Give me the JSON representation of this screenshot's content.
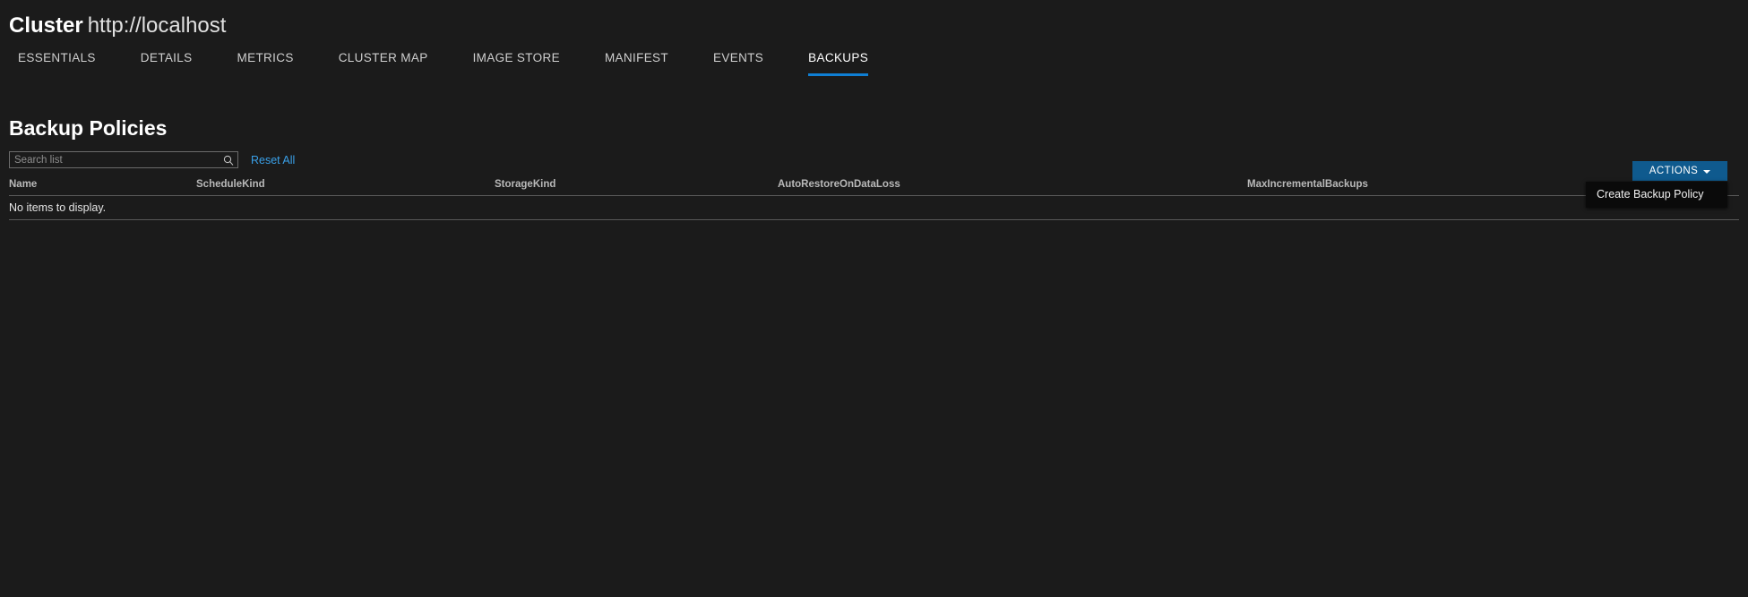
{
  "header": {
    "resource_type": "Cluster",
    "resource_name": "http://localhost"
  },
  "tabs": [
    {
      "label": "ESSENTIALS",
      "active": false
    },
    {
      "label": "DETAILS",
      "active": false
    },
    {
      "label": "METRICS",
      "active": false
    },
    {
      "label": "CLUSTER MAP",
      "active": false
    },
    {
      "label": "IMAGE STORE",
      "active": false
    },
    {
      "label": "MANIFEST",
      "active": false
    },
    {
      "label": "EVENTS",
      "active": false
    },
    {
      "label": "BACKUPS",
      "active": true
    }
  ],
  "actions": {
    "button_label": "ACTIONS",
    "menu_items": [
      {
        "label": "Create Backup Policy"
      }
    ]
  },
  "list": {
    "title": "Backup Policies",
    "search_placeholder": "Search list",
    "search_value": "",
    "reset_label": "Reset All",
    "columns": [
      "Name",
      "ScheduleKind",
      "StorageKind",
      "AutoRestoreOnDataLoss",
      "MaxIncrementalBackups"
    ],
    "rows": [],
    "empty_text": "No items to display."
  },
  "colors": {
    "background": "#1b1b1b",
    "accent": "#0f7fd4",
    "button": "#0f5a8e",
    "link": "#3aa0e8",
    "menu_background": "#0a0a0a",
    "rule": "#585858"
  }
}
